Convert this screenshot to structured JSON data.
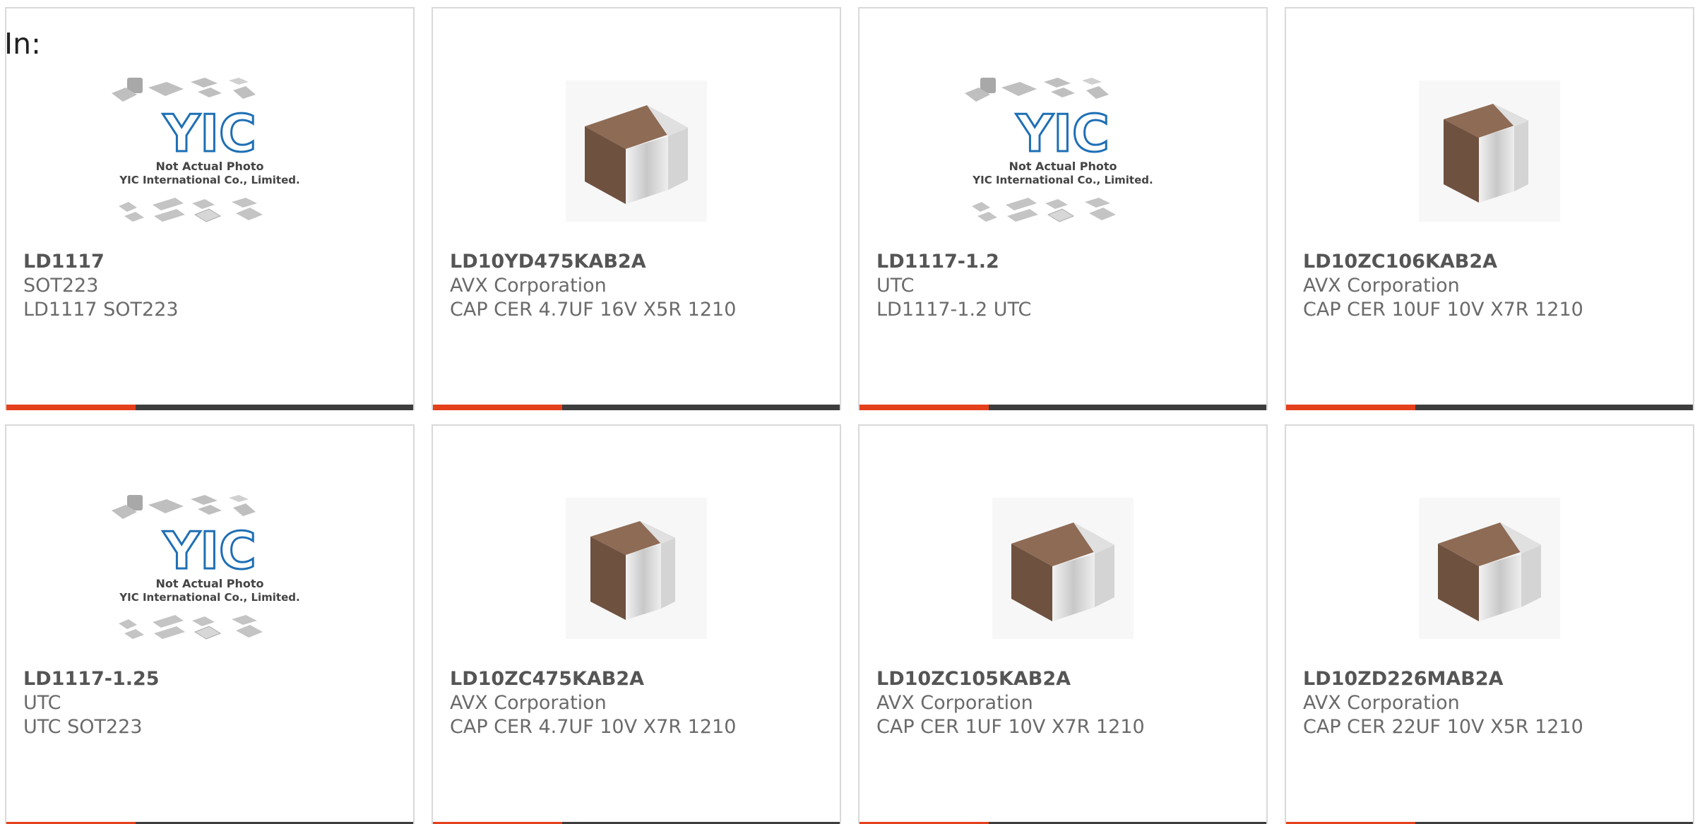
{
  "heading": "In:",
  "placeholder": {
    "line1": "Not Actual Photo",
    "line2": "YIC International Co., Limited.",
    "logo_text": "YIC"
  },
  "colors": {
    "accent": "#e4401c",
    "bar": "#3d3d3d",
    "border": "#d9d9d9",
    "logo": "#1e6fb4",
    "capacitor_body": "#7a5a47"
  },
  "products": [
    {
      "part": "LD1117",
      "manufacturer": "SOT223",
      "description": "LD1117 SOT223",
      "image": "yic-placeholder-icon"
    },
    {
      "part": "LD10YD475KAB2A",
      "manufacturer": "AVX Corporation",
      "description": "CAP CER 4.7UF 16V X5R 1210",
      "image": "capacitor-icon"
    },
    {
      "part": "LD1117-1.2",
      "manufacturer": "UTC",
      "description": "LD1117-1.2 UTC",
      "image": "yic-placeholder-icon"
    },
    {
      "part": "LD10ZC106KAB2A",
      "manufacturer": "AVX Corporation",
      "description": "CAP CER 10UF 10V X7R 1210",
      "image": "capacitor-icon"
    },
    {
      "part": "LD1117-1.25",
      "manufacturer": "UTC",
      "description": "UTC SOT223",
      "image": "yic-placeholder-icon"
    },
    {
      "part": "LD10ZC475KAB2A",
      "manufacturer": "AVX Corporation",
      "description": "CAP CER 4.7UF 10V X7R 1210",
      "image": "capacitor-icon"
    },
    {
      "part": "LD10ZC105KAB2A",
      "manufacturer": "AVX Corporation",
      "description": "CAP CER 1UF 10V X7R 1210",
      "image": "capacitor-icon"
    },
    {
      "part": "LD10ZD226MAB2A",
      "manufacturer": "AVX Corporation",
      "description": "CAP CER 22UF 10V X5R 1210",
      "image": "capacitor-icon"
    }
  ]
}
